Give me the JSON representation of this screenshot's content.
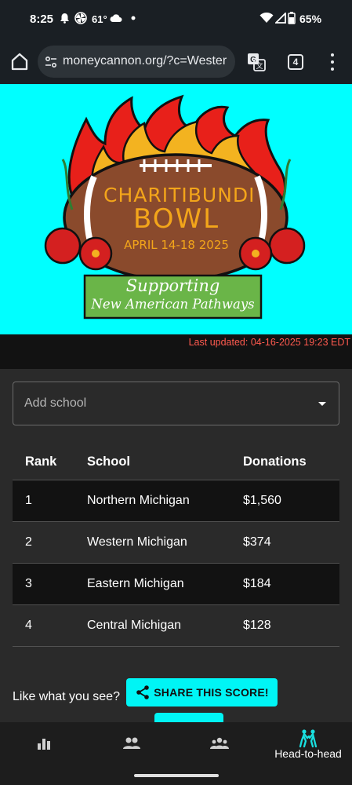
{
  "status_bar": {
    "time": "8:25",
    "temperature": "61°",
    "battery": "65%"
  },
  "browser": {
    "url": "moneycannon.org/?c=Wester",
    "tab_count": "4"
  },
  "hero": {
    "title_line1": "CHARITIBUNDI",
    "title_line2": "BOWL",
    "dates": "APRIL 14-18 2025",
    "banner_line1": "Supporting",
    "banner_line2": "New American Pathways",
    "background_color": "#00ffff"
  },
  "last_updated": "Last updated: 04-16-2025 19:23 EDT",
  "add_school": {
    "label": "Add school",
    "icon": "dropdown-caret-icon"
  },
  "table": {
    "headers": [
      "Rank",
      "School",
      "Donations"
    ],
    "rows": [
      {
        "rank": "1",
        "school": "Northern Michigan",
        "donations": "$1,560"
      },
      {
        "rank": "2",
        "school": "Western Michigan",
        "donations": "$374"
      },
      {
        "rank": "3",
        "school": "Eastern Michigan",
        "donations": "$184"
      },
      {
        "rank": "4",
        "school": "Central Michigan",
        "donations": "$128"
      }
    ]
  },
  "share": {
    "prompt": "Like what you see?",
    "button_label": "SHARE THIS SCORE!",
    "accent_color": "#00f5f5"
  },
  "bottom_nav": {
    "items": [
      {
        "icon": "bar-chart-icon",
        "label": ""
      },
      {
        "icon": "people-icon",
        "label": ""
      },
      {
        "icon": "groups-icon",
        "label": ""
      },
      {
        "icon": "head-to-head-icon",
        "label": "Head-to-head",
        "active": true
      }
    ]
  }
}
